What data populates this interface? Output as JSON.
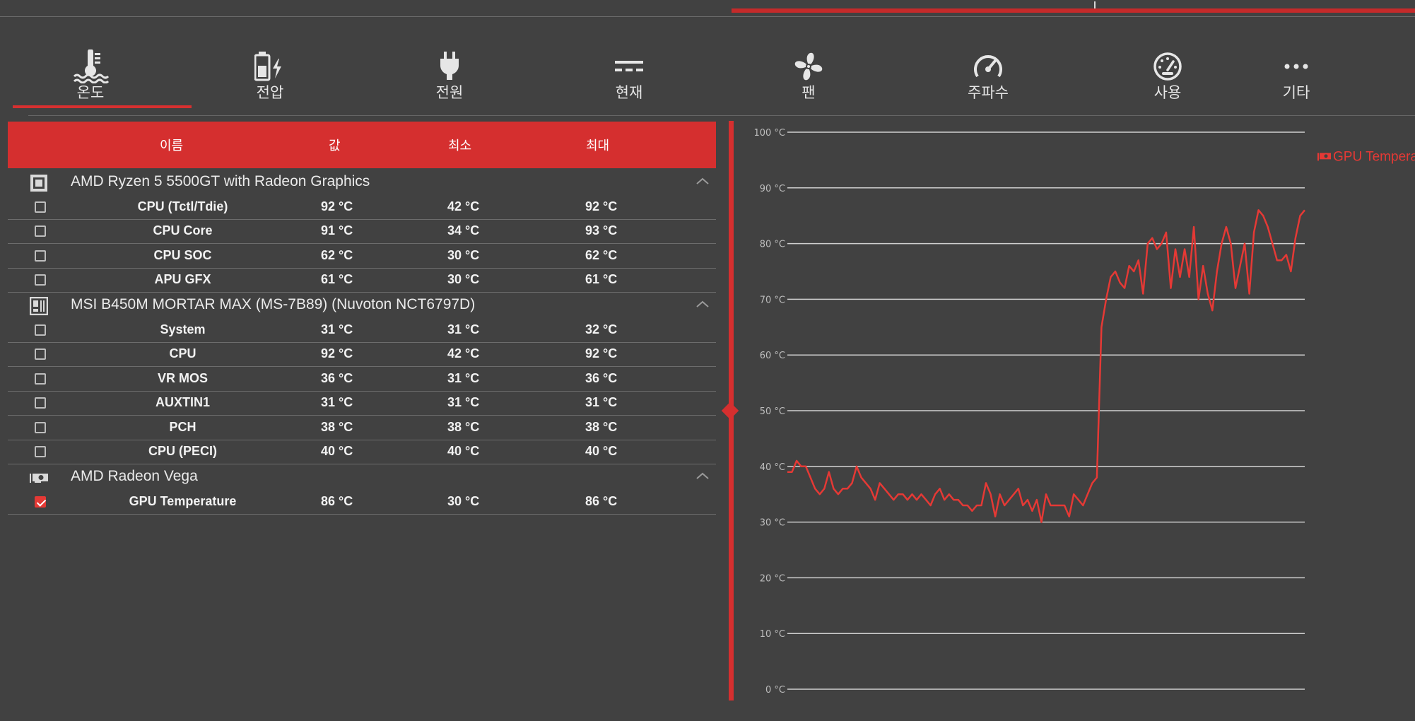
{
  "tabs": [
    {
      "id": "temperature",
      "label": "온도",
      "icon": "thermometer-icon",
      "active": true
    },
    {
      "id": "voltage",
      "label": "전압",
      "icon": "battery-bolt-icon",
      "active": false
    },
    {
      "id": "power",
      "label": "전원",
      "icon": "plug-icon",
      "active": false
    },
    {
      "id": "current",
      "label": "현재",
      "icon": "dc-current-icon",
      "active": false
    },
    {
      "id": "fan",
      "label": "팬",
      "icon": "fan-icon",
      "active": false
    },
    {
      "id": "clock",
      "label": "주파수",
      "icon": "speedometer-icon",
      "active": false
    },
    {
      "id": "load",
      "label": "사용",
      "icon": "gauge-icon",
      "active": false
    },
    {
      "id": "other",
      "label": "기타",
      "icon": "more-dots-icon",
      "active": false
    }
  ],
  "table": {
    "headers": {
      "name": "이름",
      "value": "값",
      "min": "최소",
      "max": "최대"
    },
    "groups": [
      {
        "name": "AMD Ryzen 5 5500GT with Radeon Graphics",
        "icon": "cpu-icon",
        "sensors": [
          {
            "name": "CPU (Tctl/Tdie)",
            "value": "92 °C",
            "min": "42 °C",
            "max": "92 °C",
            "checked": false
          },
          {
            "name": "CPU Core",
            "value": "91 °C",
            "min": "34 °C",
            "max": "93 °C",
            "checked": false
          },
          {
            "name": "CPU SOC",
            "value": "62 °C",
            "min": "30 °C",
            "max": "62 °C",
            "checked": false
          },
          {
            "name": "APU GFX",
            "value": "61 °C",
            "min": "30 °C",
            "max": "61 °C",
            "checked": false
          }
        ]
      },
      {
        "name": "MSI B450M MORTAR MAX (MS-7B89) (Nuvoton NCT6797D)",
        "icon": "motherboard-icon",
        "sensors": [
          {
            "name": "System",
            "value": "31 °C",
            "min": "31 °C",
            "max": "32 °C",
            "checked": false
          },
          {
            "name": "CPU",
            "value": "92 °C",
            "min": "42 °C",
            "max": "92 °C",
            "checked": false
          },
          {
            "name": "VR MOS",
            "value": "36 °C",
            "min": "31 °C",
            "max": "36 °C",
            "checked": false
          },
          {
            "name": "AUXTIN1",
            "value": "31 °C",
            "min": "31 °C",
            "max": "31 °C",
            "checked": false
          },
          {
            "name": "PCH",
            "value": "38 °C",
            "min": "38 °C",
            "max": "38 °C",
            "checked": false
          },
          {
            "name": "CPU (PECI)",
            "value": "40 °C",
            "min": "40 °C",
            "max": "40 °C",
            "checked": false
          }
        ]
      },
      {
        "name": "AMD Radeon Vega",
        "icon": "gpu-icon",
        "sensors": [
          {
            "name": "GPU Temperature",
            "value": "86 °C",
            "min": "30 °C",
            "max": "86 °C",
            "checked": true
          }
        ]
      }
    ]
  },
  "colors": {
    "accent": "#d52f2f",
    "series": "#e53935",
    "background": "#414141"
  },
  "chart_data": {
    "type": "line",
    "title": "",
    "xlabel": "",
    "ylabel": "",
    "ylim": [
      0,
      100
    ],
    "y_ticks": [
      "0 °C",
      "10 °C",
      "20 °C",
      "30 °C",
      "40 °C",
      "50 °C",
      "60 °C",
      "70 °C",
      "80 °C",
      "90 °C",
      "100 °C"
    ],
    "grid": true,
    "legend_position": "right",
    "series": [
      {
        "name": "GPU Temperature",
        "color": "#e53935",
        "values": [
          39,
          39,
          41,
          40,
          40,
          38,
          36,
          35,
          36,
          39,
          36,
          35,
          36,
          36,
          37,
          40,
          38,
          37,
          36,
          34,
          37,
          36,
          35,
          34,
          35,
          35,
          34,
          35,
          34,
          35,
          34,
          33,
          35,
          36,
          34,
          35,
          34,
          34,
          33,
          33,
          32,
          33,
          33,
          37,
          35,
          31,
          35,
          33,
          34,
          35,
          36,
          33,
          34,
          32,
          34,
          30,
          35,
          33,
          33,
          33,
          33,
          31,
          35,
          34,
          33,
          35,
          37,
          38,
          65,
          70,
          74,
          75,
          73,
          72,
          76,
          75,
          77,
          71,
          80,
          81,
          79,
          80,
          82,
          72,
          79,
          74,
          79,
          74,
          83,
          70,
          76,
          71,
          68,
          75,
          80,
          83,
          80,
          72,
          76,
          80,
          71,
          82,
          86,
          85,
          83,
          80,
          77,
          77,
          78,
          75,
          81,
          85,
          86
        ]
      }
    ]
  }
}
